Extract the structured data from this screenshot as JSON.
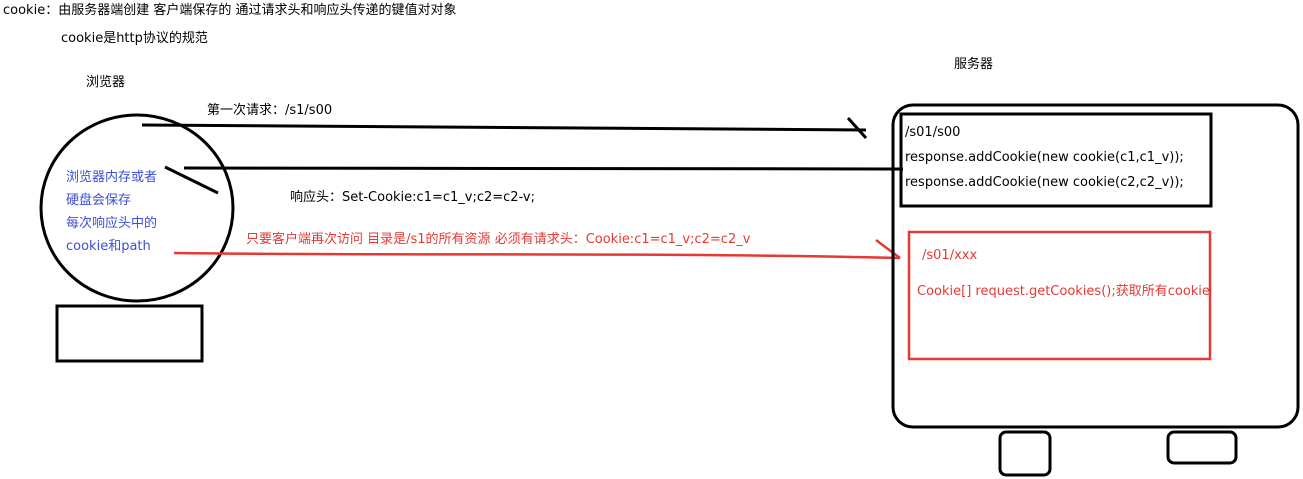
{
  "header": {
    "definition": "cookie：由服务器端创建 客户端保存的 通过请求头和响应头传递的键值对对象",
    "spec_note": "cookie是http协议的规范"
  },
  "browser": {
    "label": "浏览器",
    "note_lines": [
      "浏览器内存或者",
      "硬盘会保存",
      "每次响应头中的",
      "cookie和path"
    ]
  },
  "server": {
    "label": "服务器",
    "handler1": {
      "path": "/s01/s00",
      "lines": [
        "response.addCookie(new cookie(c1,c1_v));",
        "response.addCookie(new cookie(c2,c2_v));"
      ]
    },
    "handler2": {
      "path": "/s01/xxx",
      "line": "Cookie[] request.getCookies();获取所有cookie"
    }
  },
  "arrows": {
    "request": "第一次请求：/s1/s00",
    "response": "响应头：Set-Cookie:c1=c1_v;c2=c2-v;",
    "revisit": "只要客户端再次访问 目录是/s1的所有资源  必须有请求头：Cookie:c1=c1_v;c2=c2_v"
  },
  "colors": {
    "ink": "#000000",
    "red": "#e53935",
    "blue": "#3b4fd8"
  }
}
